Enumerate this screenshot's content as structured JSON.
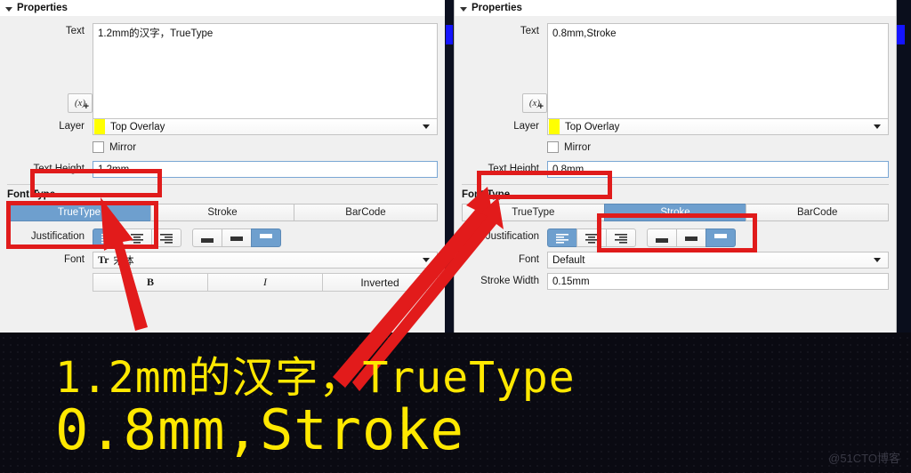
{
  "colors": {
    "accent_selected": "#6e9fce",
    "annotation_red": "#e01b1b",
    "layer_swatch": "#ffff00",
    "canvas_text_yellow": "#ffe800",
    "panel_bg": "#f0f0f0"
  },
  "panel_left": {
    "title": "Properties",
    "text_label": "Text",
    "text_value": "1.2mm的汉字，TrueType",
    "text_placeholder": "",
    "variable_button": "(x)+",
    "layer_label": "Layer",
    "layer_value": "Top Overlay",
    "mirror_label": "Mirror",
    "mirror_checked": false,
    "text_height_label": "Text Height",
    "text_height_value": "1.2mm",
    "font_type_header": "Font Type",
    "font_type_options": [
      "TrueType",
      "Stroke",
      "BarCode"
    ],
    "font_type_selected": "TrueType",
    "justification_label": "Justification",
    "justification_horizontal": [
      "align-left",
      "align-center",
      "align-right"
    ],
    "justification_horizontal_selected": 0,
    "justification_vertical": [
      "align-bottom",
      "align-middle",
      "align-top"
    ],
    "justification_vertical_selected": 2,
    "font_label": "Font",
    "font_value": "宋体",
    "style_buttons": [
      "B",
      "I",
      "Inverted"
    ]
  },
  "panel_right": {
    "title": "Properties",
    "text_label": "Text",
    "text_value": "0.8mm,Stroke",
    "text_placeholder": "",
    "variable_button": "(x)+",
    "layer_label": "Layer",
    "layer_value": "Top Overlay",
    "mirror_label": "Mirror",
    "mirror_checked": false,
    "text_height_label": "Text Height",
    "text_height_value": "0.8mm",
    "font_type_header": "Font Type",
    "font_type_options": [
      "TrueType",
      "Stroke",
      "BarCode"
    ],
    "font_type_selected": "Stroke",
    "justification_label": "Justification",
    "justification_horizontal": [
      "align-left",
      "align-center",
      "align-right"
    ],
    "justification_horizontal_selected": 0,
    "justification_vertical": [
      "align-bottom",
      "align-middle",
      "align-top"
    ],
    "justification_vertical_selected": 2,
    "font_label": "Font",
    "font_value": "Default",
    "stroke_width_label": "Stroke Width",
    "stroke_width_value": "0.15mm"
  },
  "canvas": {
    "line1": "1.2mm的汉字，TrueType",
    "line2": "0.8mm,Stroke",
    "watermark": "@51CTO博客"
  }
}
